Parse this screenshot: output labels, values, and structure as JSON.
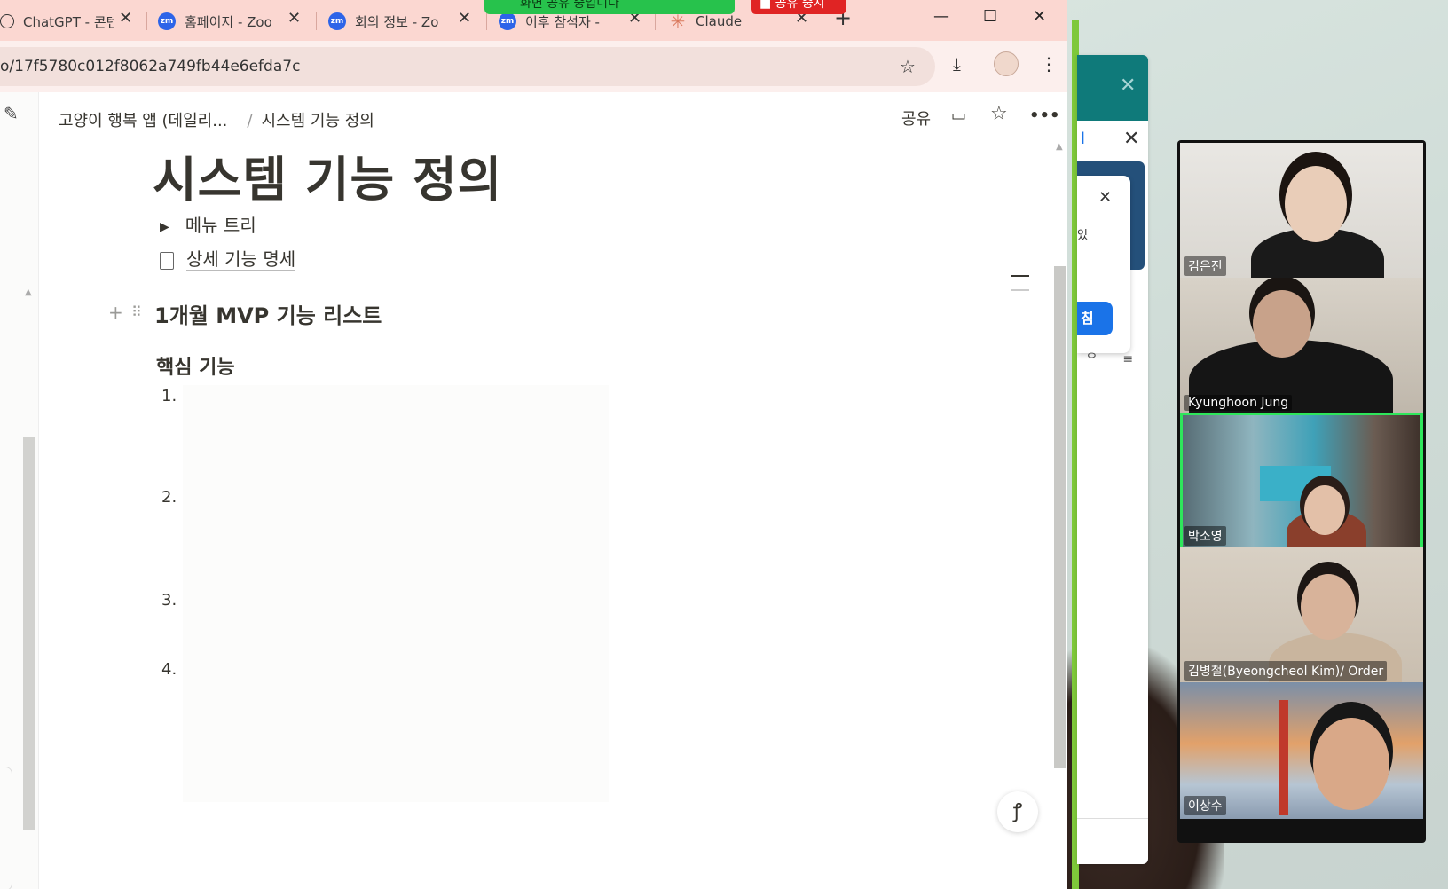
{
  "browser": {
    "tabs": [
      {
        "label": "ChatGPT - 콘텐",
        "favicon": "chatgpt-icon"
      },
      {
        "label": "홈페이지 - Zoo",
        "favicon": "zoom-icon"
      },
      {
        "label": "회의 정보 - Zo",
        "favicon": "zoom-icon"
      },
      {
        "label": "이후 참석자 - ",
        "favicon": "zoom-icon"
      },
      {
        "label": "Claude",
        "favicon": "claude-icon"
      }
    ],
    "favicon_text": "zm",
    "close_glyph": "✕",
    "new_tab": "+",
    "window_controls": {
      "minimize": "—",
      "maximize": "☐",
      "close": "✕"
    },
    "url": "o/17f5780c012f8062a749fb44e6efda7c"
  },
  "share_banner": {
    "text": "화면 공유 중입니다",
    "stop": "■ 공유 중지"
  },
  "notion": {
    "breadcrumb": [
      "고양이 행복 앱 (데일리...",
      "시스템 기능 정의"
    ],
    "breadcrumb_sep": "/",
    "share_label": "공유",
    "page_title": "시스템 기능 정의",
    "toggle_label": "메뉴 트리",
    "subpage_label": "상세 기능 명세",
    "heading2": "1개월 MVP 기능 리스트",
    "heading3": "핵심 기능",
    "list_numbers": [
      "1.",
      "2.",
      "3.",
      "4."
    ]
  },
  "zoom_panel": {
    "button_text": "침",
    "side_text": "었"
  },
  "participants": [
    {
      "name": "김은진"
    },
    {
      "name": "Kyunghoon Jung"
    },
    {
      "name": "박소영",
      "active": true
    },
    {
      "name": "김병철(Byeongcheol Kim)/ Order"
    },
    {
      "name": "이상수"
    }
  ],
  "colors": {
    "tabbar": "#fbd7d1",
    "share_green": "#27c24c",
    "stop_red": "#e02424",
    "active_speaker": "#2ee65b",
    "zoom_teal": "#0f7a7a",
    "zoom_blue": "#1a73e8"
  }
}
